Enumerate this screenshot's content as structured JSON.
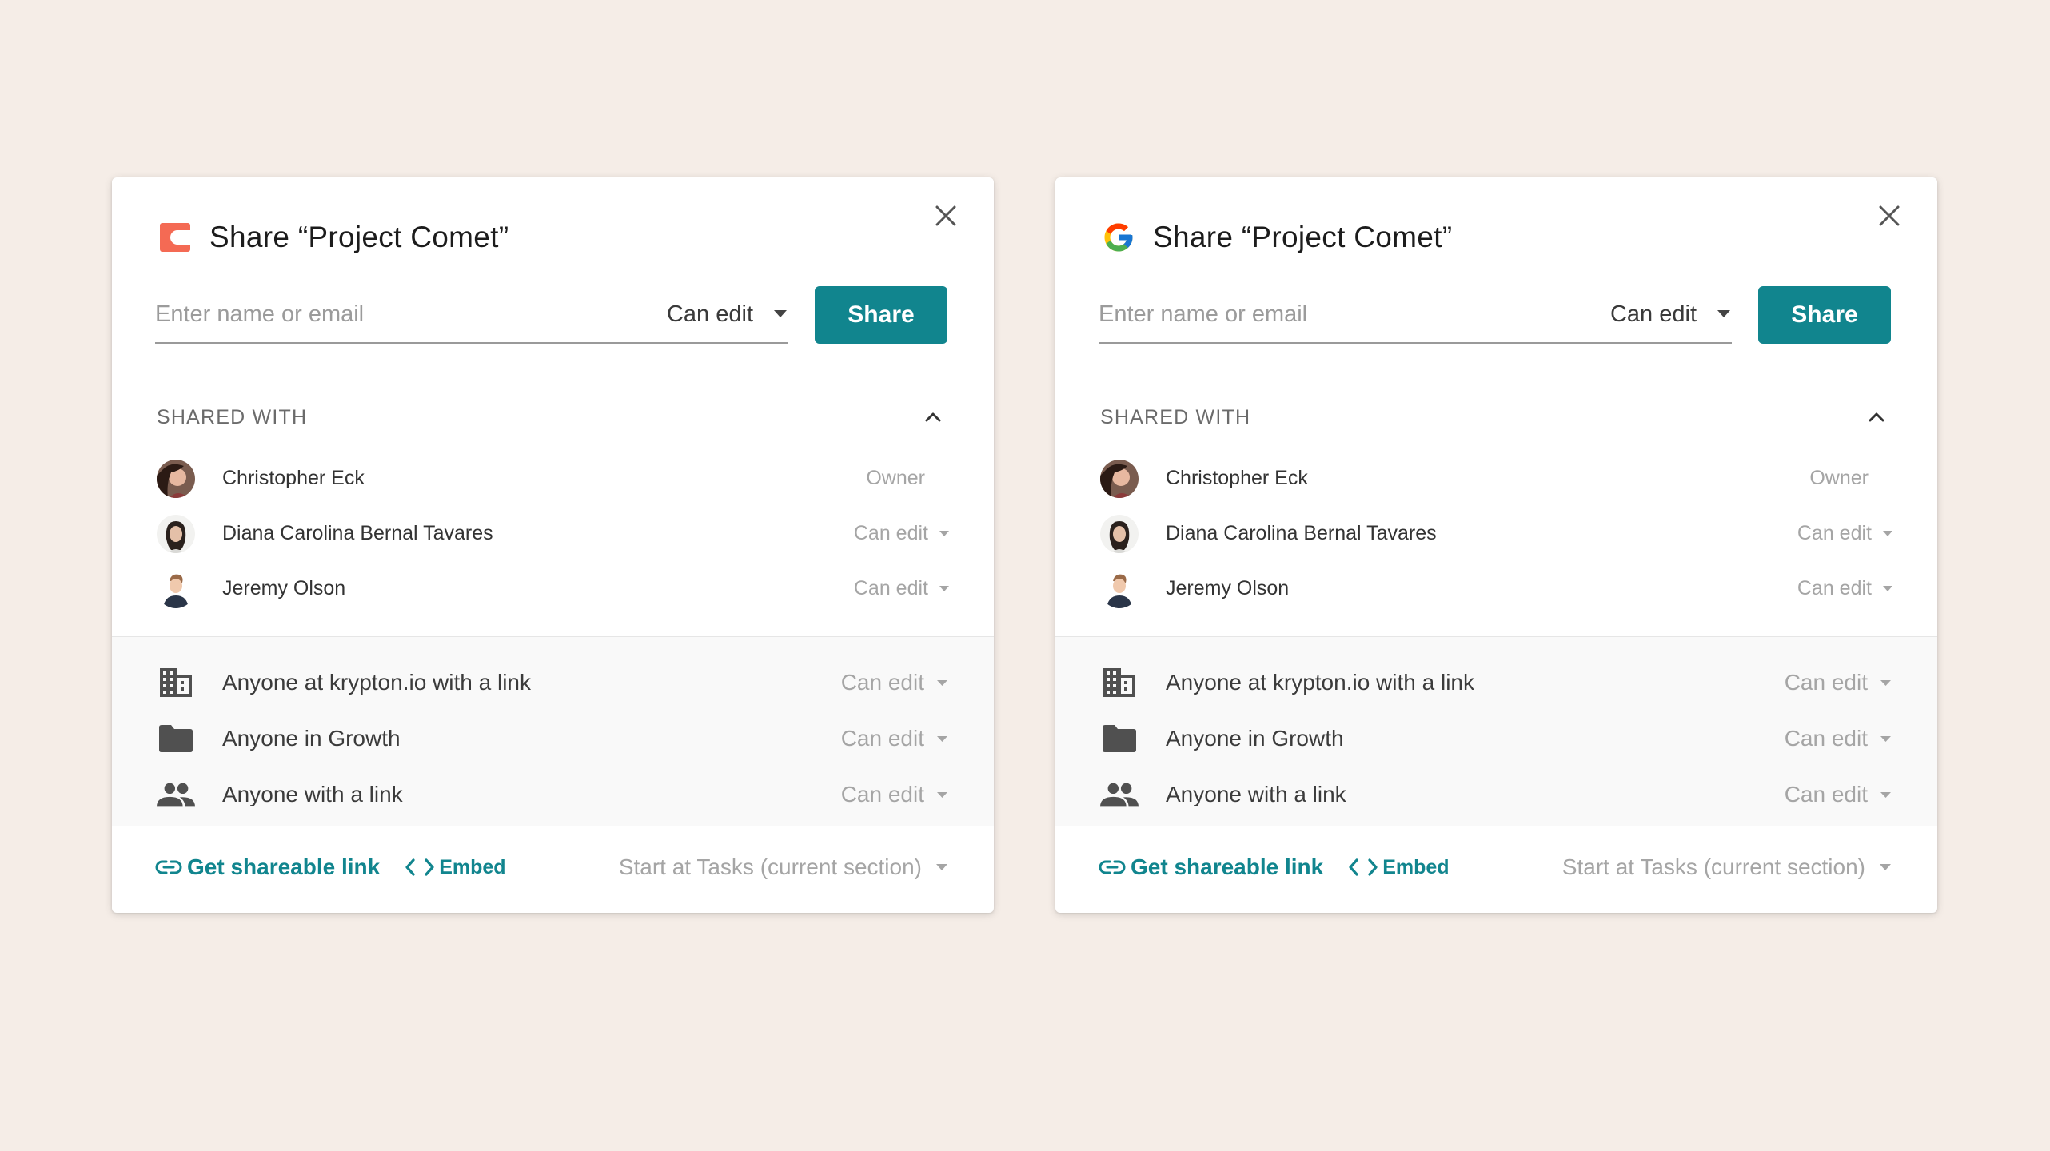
{
  "colors": {
    "background": "#f5ede7",
    "accent": "#11858e",
    "muted_text": "#a5a5a5"
  },
  "dialogs": [
    {
      "logo_icon": "coda-logo-icon",
      "title": "Share “Project Comet”",
      "input_placeholder": "Enter name or email",
      "permission_select": "Can edit",
      "share_button": "Share",
      "section_label": "SHARED WITH",
      "people": [
        {
          "name": "Christopher Eck",
          "role": "Owner"
        },
        {
          "name": "Diana Carolina Bernal Tavares",
          "role": "Can edit"
        },
        {
          "name": "Jeremy Olson",
          "role": "Can edit"
        }
      ],
      "groups": [
        {
          "icon": "building-icon",
          "label": "Anyone at krypton.io with a link",
          "permission": "Can edit"
        },
        {
          "icon": "folder-icon",
          "label": "Anyone in Growth",
          "permission": "Can edit"
        },
        {
          "icon": "people-icon",
          "label": "Anyone with a link",
          "permission": "Can edit"
        }
      ],
      "footer": {
        "shareable_link": "Get shareable link",
        "embed": "Embed",
        "start_at": "Start at Tasks (current section)"
      }
    },
    {
      "logo_icon": "google-logo-icon",
      "title": "Share “Project Comet”",
      "input_placeholder": "Enter name or email",
      "permission_select": "Can edit",
      "share_button": "Share",
      "section_label": "SHARED WITH",
      "people": [
        {
          "name": "Christopher Eck",
          "role": "Owner"
        },
        {
          "name": "Diana Carolina Bernal Tavares",
          "role": "Can edit"
        },
        {
          "name": "Jeremy Olson",
          "role": "Can edit"
        }
      ],
      "groups": [
        {
          "icon": "building-icon",
          "label": "Anyone at krypton.io with a link",
          "permission": "Can edit"
        },
        {
          "icon": "folder-icon",
          "label": "Anyone in Growth",
          "permission": "Can edit"
        },
        {
          "icon": "people-icon",
          "label": "Anyone with a link",
          "permission": "Can edit"
        }
      ],
      "footer": {
        "shareable_link": "Get shareable link",
        "embed": "Embed",
        "start_at": "Start at Tasks (current section)"
      }
    }
  ]
}
